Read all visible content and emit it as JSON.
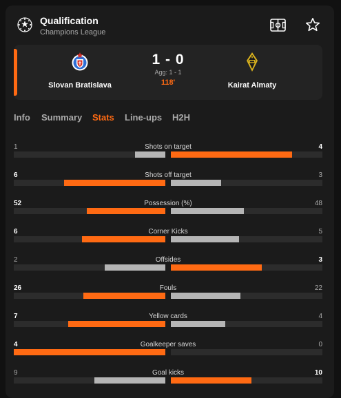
{
  "header": {
    "title": "Qualification",
    "subtitle": "Champions League",
    "icons": {
      "competition": "champions-league-icon",
      "pitch": "pitch-icon",
      "favorite": "star-icon"
    }
  },
  "match": {
    "home": {
      "name": "Slovan Bratislava",
      "crest": "slovan-bratislava-crest"
    },
    "away": {
      "name": "Kairat Almaty",
      "crest": "kairat-almaty-crest"
    },
    "score": "1 - 0",
    "aggregate": "Agg: 1 - 1",
    "minute": "118'"
  },
  "tabs": [
    {
      "label": "Info",
      "active": false
    },
    {
      "label": "Summary",
      "active": false
    },
    {
      "label": "Stats",
      "active": true
    },
    {
      "label": "Line-ups",
      "active": false
    },
    {
      "label": "H2H",
      "active": false
    }
  ],
  "colors": {
    "accent": "#ff6a13",
    "neutral_bar": "#b5b5b5"
  },
  "stats": [
    {
      "label": "Shots on target",
      "home": "1",
      "away": "4",
      "home_frac": 0.2,
      "away_frac": 0.8,
      "winner": "away"
    },
    {
      "label": "Shots off target",
      "home": "6",
      "away": "3",
      "home_frac": 0.67,
      "away_frac": 0.33,
      "winner": "home"
    },
    {
      "label": "Possession (%)",
      "home": "52",
      "away": "48",
      "home_frac": 0.52,
      "away_frac": 0.48,
      "winner": "home"
    },
    {
      "label": "Corner Kicks",
      "home": "6",
      "away": "5",
      "home_frac": 0.55,
      "away_frac": 0.45,
      "winner": "home"
    },
    {
      "label": "Offsides",
      "home": "2",
      "away": "3",
      "home_frac": 0.4,
      "away_frac": 0.6,
      "winner": "away"
    },
    {
      "label": "Fouls",
      "home": "26",
      "away": "22",
      "home_frac": 0.54,
      "away_frac": 0.46,
      "winner": "home"
    },
    {
      "label": "Yellow cards",
      "home": "7",
      "away": "4",
      "home_frac": 0.64,
      "away_frac": 0.36,
      "winner": "home"
    },
    {
      "label": "Goalkeeper saves",
      "home": "4",
      "away": "0",
      "home_frac": 1.0,
      "away_frac": 0.0,
      "winner": "home"
    },
    {
      "label": "Goal kicks",
      "home": "9",
      "away": "10",
      "home_frac": 0.47,
      "away_frac": 0.53,
      "winner": "away"
    }
  ]
}
